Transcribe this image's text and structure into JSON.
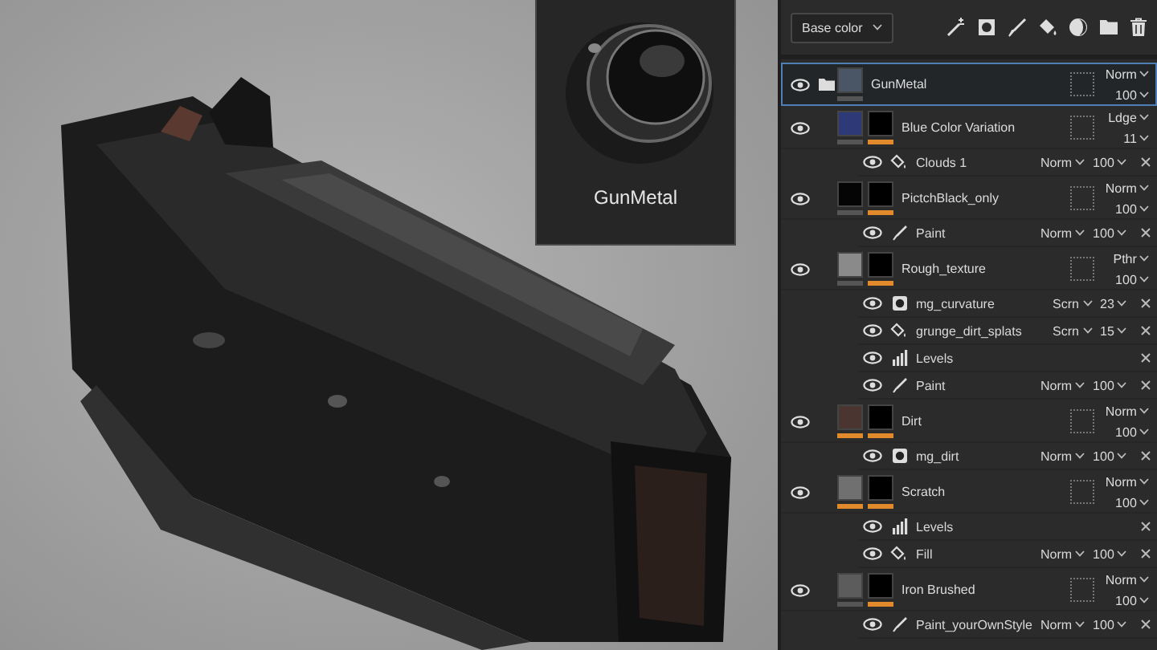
{
  "viewport": {
    "material_preview": {
      "label": "GunMetal"
    }
  },
  "layers_panel": {
    "channel_dropdown": {
      "value": "Base color"
    },
    "layers": [
      {
        "name": "GunMetal",
        "kind": "folder",
        "selected": true,
        "color": "#4a5666",
        "mask": false,
        "content_bar_on": false,
        "blend": "Norm",
        "opacity": "100"
      },
      {
        "name": "Blue Color Variation",
        "kind": "layer",
        "selected": false,
        "color": "#2e3a78",
        "mask": true,
        "content_bar_on": false,
        "blend": "Ldge",
        "opacity": "11",
        "effects": [
          {
            "name": "Clouds 1",
            "kind": "fill",
            "blend": "Norm",
            "opacity": "100"
          }
        ]
      },
      {
        "name": "PictchBlack_only",
        "kind": "layer",
        "selected": false,
        "color": "#050505",
        "mask": true,
        "content_bar_on": false,
        "blend": "Norm",
        "opacity": "100",
        "effects": [
          {
            "name": "Paint",
            "kind": "paint",
            "blend": "Norm",
            "opacity": "100"
          }
        ]
      },
      {
        "name": "Rough_texture",
        "kind": "layer",
        "selected": false,
        "color": "#8a8a8a",
        "mask": true,
        "content_bar_on": false,
        "blend": "Pthr",
        "opacity": "100",
        "effects": [
          {
            "name": "mg_curvature",
            "kind": "generator",
            "blend": "Scrn",
            "opacity": "23"
          },
          {
            "name": "grunge_dirt_splats",
            "kind": "fill",
            "blend": "Scrn",
            "opacity": "15"
          },
          {
            "name": "Levels",
            "kind": "levels"
          },
          {
            "name": "Paint",
            "kind": "paint",
            "blend": "Norm",
            "opacity": "100"
          }
        ]
      },
      {
        "name": "Dirt",
        "kind": "layer",
        "selected": false,
        "color": "#4a3530",
        "mask": true,
        "content_bar_on": true,
        "blend": "Norm",
        "opacity": "100",
        "effects": [
          {
            "name": "mg_dirt",
            "kind": "generator",
            "blend": "Norm",
            "opacity": "100"
          }
        ]
      },
      {
        "name": "Scratch",
        "kind": "layer",
        "selected": false,
        "color": "#707070",
        "mask": true,
        "content_bar_on": true,
        "blend": "Norm",
        "opacity": "100",
        "effects": [
          {
            "name": "Levels",
            "kind": "levels"
          },
          {
            "name": "Fill",
            "kind": "fill",
            "blend": "Norm",
            "opacity": "100"
          }
        ]
      },
      {
        "name": "Iron Brushed",
        "kind": "layer",
        "selected": false,
        "color": "#5c5c5c",
        "mask": true,
        "content_bar_on": false,
        "blend": "Norm",
        "opacity": "100",
        "effects": [
          {
            "name": "Paint_yourOwnStyle",
            "kind": "paint",
            "blend": "Norm",
            "opacity": "100"
          }
        ]
      }
    ]
  }
}
